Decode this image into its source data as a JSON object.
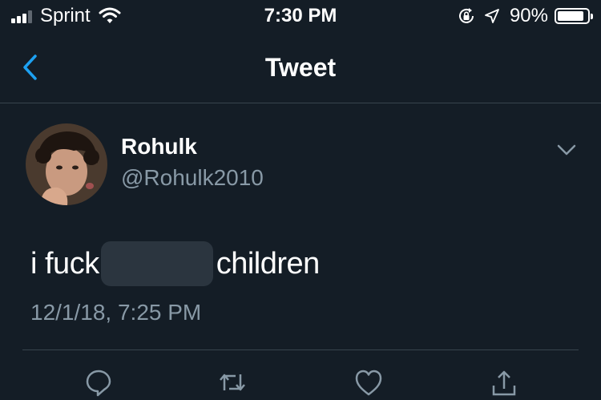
{
  "status_bar": {
    "carrier": "Sprint",
    "time": "7:30 PM",
    "battery_percent": "90%",
    "battery_level": 0.9,
    "icons": [
      "signal-icon",
      "wifi-icon",
      "rotation-lock-icon",
      "location-icon",
      "battery-icon"
    ]
  },
  "nav": {
    "title": "Tweet",
    "back_icon": "chevron-left-icon"
  },
  "tweet": {
    "author_name": "Rohulk",
    "author_handle": "@Rohulk2010",
    "text_before": "i fuck",
    "text_after": "children",
    "timestamp": "12/1/18, 7:25 PM",
    "menu_icon": "chevron-down-icon"
  },
  "actions": [
    "reply-icon",
    "retweet-icon",
    "like-icon",
    "share-icon"
  ],
  "colors": {
    "background": "#141d26",
    "text": "#ffffff",
    "secondary_text": "#8899a6",
    "accent": "#1da1f2",
    "divider": "#38444d"
  }
}
